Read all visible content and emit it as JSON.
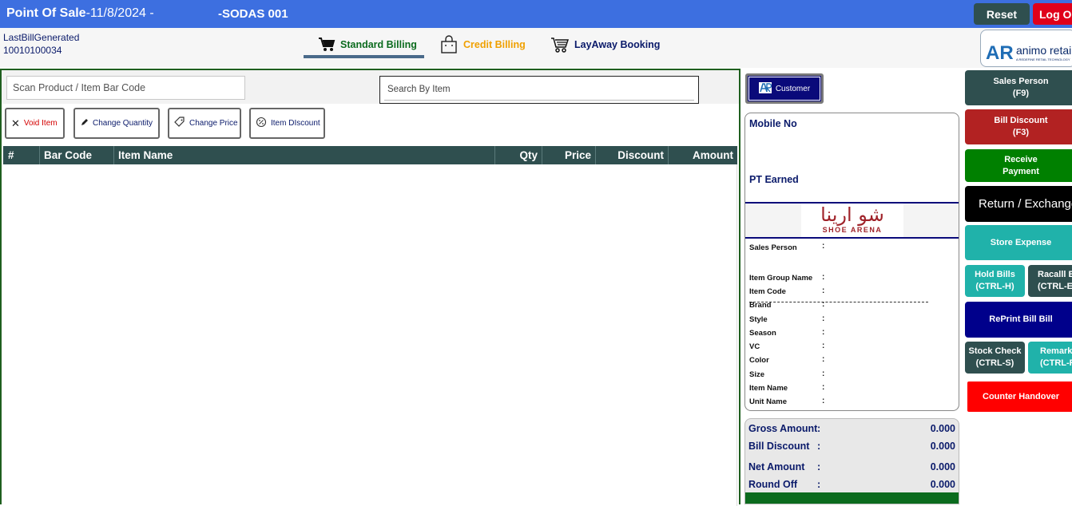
{
  "header": {
    "app_title": "Point Of Sale",
    "date": "-11/8/2024 -",
    "store": "-SODAS 001",
    "reset_label": "Reset",
    "logout_label": "Log Out"
  },
  "last_bill": {
    "label": "LastBillGenerated",
    "number": "10010100034"
  },
  "billing_tabs": [
    {
      "label": "Standard Billing",
      "icon": "cart-icon",
      "active": true,
      "color": "#0b6b1e"
    },
    {
      "label": "Credit Billing",
      "icon": "shopping-bag-icon",
      "active": false,
      "color": "#f0a000"
    },
    {
      "label": "LayAway Booking",
      "icon": "trolley-icon",
      "active": false,
      "color": "#0a1a6a"
    }
  ],
  "logo": {
    "mark": "AR",
    "name": "animo retail",
    "tagline": "A REDEFINE RETAIL TECHNOLOGY"
  },
  "scan": {
    "placeholder": "Scan Product / Item  Bar Code"
  },
  "search": {
    "placeholder": "Search By Item"
  },
  "actions": [
    {
      "label": "Void Item",
      "icon": "close-icon",
      "color": "#d40000"
    },
    {
      "label": "Change Quantity",
      "icon": "pencil-icon",
      "color": "#0a1a6a"
    },
    {
      "label": "Change Price",
      "icon": "price-tag-icon",
      "color": "#0a1a6a"
    },
    {
      "label": "Item DIscount",
      "icon": "discount-icon",
      "color": "#0a1a6a"
    }
  ],
  "grid": {
    "columns": [
      "#",
      "Bar Code",
      "Item Name",
      "Qty",
      "Price",
      "Discount",
      "Amount"
    ],
    "rows": []
  },
  "customer": {
    "button_label": "Customer",
    "mobile_label": "Mobile No",
    "points_label": "PT Earned"
  },
  "brand": {
    "arabic": "شو ارينا",
    "english": "SHOE ARENA"
  },
  "details": {
    "sales_person_label": "Sales Person",
    "fields": [
      "Item Group Name",
      "Item Code",
      "Brand",
      "Style",
      "Season",
      "VC",
      "Color",
      "Size",
      "Item Name",
      "Unit Name"
    ]
  },
  "totals": [
    {
      "label": "Gross Amount",
      "value": "0.000"
    },
    {
      "label": "Bill Discount",
      "value": "0.000"
    },
    {
      "label": "Net Amount",
      "value": "0.000"
    },
    {
      "label": "Round Off",
      "value": "0.000"
    }
  ],
  "side_buttons": {
    "sales_person": {
      "line1": "Sales Person",
      "line2": "(F9)",
      "color": "#2f4f4f"
    },
    "bill_discount": {
      "line1": "Bill Discount",
      "line2": "(F3)",
      "color": "#b22222"
    },
    "receive_payment": {
      "line1": "Receive",
      "line2": "Payment",
      "color": "#008000"
    },
    "return_exchange": {
      "label": "Return / Exchange",
      "color": "#000000"
    },
    "store_expense": {
      "label": "Store Expense",
      "color": "#20b2aa"
    },
    "hold_bills": {
      "line1": "Hold Bills",
      "line2": "(CTRL-H)",
      "color": "#20b2aa"
    },
    "recall_bills": {
      "line1": "Racalll Bills",
      "line2": "(CTRL-E)",
      "color": "#2f4f4f"
    },
    "reprint": {
      "label": "RePrint Bill Bill",
      "color": "#00008b"
    },
    "stock_check": {
      "line1": "Stock Check",
      "line2": "(CTRL-S)",
      "color": "#2f4f4f"
    },
    "remarks": {
      "line1": "Remarks",
      "line2": "(CTRL-R)",
      "color": "#20b2aa"
    },
    "counter_handover": {
      "label": "Counter Handover",
      "color": "#ff0000"
    }
  }
}
